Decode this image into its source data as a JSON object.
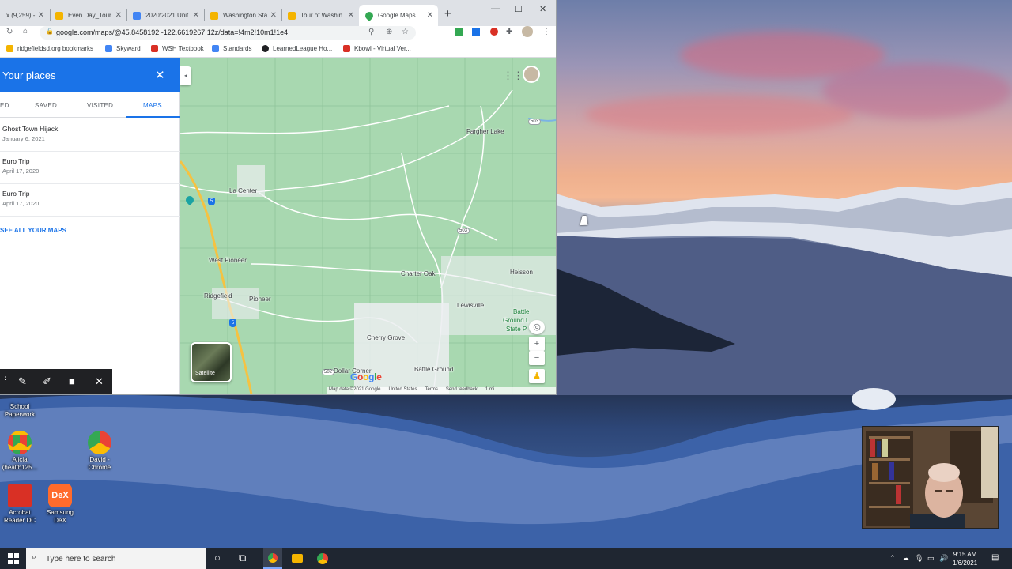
{
  "browser": {
    "tabs": [
      {
        "title": "x (9,259) -",
        "color": "#d93025"
      },
      {
        "title": "Even Day_Tour",
        "color": "#f4b400"
      },
      {
        "title": "2020/2021 Unit",
        "color": "#4285f4"
      },
      {
        "title": "Washington Sta",
        "color": "#f4b400"
      },
      {
        "title": "Tour of Washin",
        "color": "#f4b400"
      },
      {
        "title": "Google Maps",
        "color": "#34a853"
      }
    ],
    "new_tab": "+",
    "url": "google.com/maps/@45.8458192,-122.6619267,12z/data=!4m2!10m1!1e4",
    "bookmarks": [
      {
        "label": "ridgefieldsd.org bookmarks",
        "color": "#f4b400"
      },
      {
        "label": "Skyward",
        "color": "#4285f4"
      },
      {
        "label": "WSH Textbook",
        "color": "#d93025"
      },
      {
        "label": "Standards",
        "color": "#4285f4"
      },
      {
        "label": "LearnedLeague Ho...",
        "color": "#202124"
      },
      {
        "label": "Kbowl - Virtual Ver...",
        "color": "#d93025"
      }
    ]
  },
  "panel": {
    "title": "Your places",
    "tabs": [
      "ED",
      "SAVED",
      "VISITED",
      "MAPS"
    ],
    "items": [
      {
        "title": "Ghost Town Hijack",
        "date": "January 6, 2021"
      },
      {
        "title": "Euro Trip",
        "date": "April 17, 2020"
      },
      {
        "title": "Euro Trip",
        "date": "April 17, 2020"
      }
    ],
    "see_all": "SEE ALL YOUR MAPS"
  },
  "map": {
    "places": [
      "Fargher Lake",
      "La Center",
      "West Pioneer",
      "Charter Oak",
      "Heisson",
      "Ridgefield",
      "Pioneer",
      "Lewisville",
      "Battle",
      "Ground L",
      "State P",
      "Cherry Grove",
      "Dollar Corner",
      "Battle Ground"
    ],
    "shields": [
      "503",
      "503",
      "502",
      "5",
      "5"
    ],
    "satellite_label": "Satellite",
    "logo": "Google",
    "attribution": [
      "Map data ©2021 Google",
      "United States",
      "Terms",
      "Send feedback",
      "1 mi"
    ]
  },
  "desktop": {
    "icons": [
      {
        "label": "School Paperwork",
        "color": "#f4b400"
      },
      {
        "label": "Alicia (health125...",
        "color": "#4285f4"
      },
      {
        "label": "David - Chrome",
        "color": "#4285f4"
      },
      {
        "label": "Acrobat Reader DC",
        "color": "#d93025"
      },
      {
        "label": "Samsung DeX",
        "color": "#ff6b2c"
      }
    ],
    "dex_text": "DeX"
  },
  "taskbar": {
    "search_placeholder": "Type here to search",
    "time": "9:15 AM",
    "date": "1/6/2021"
  }
}
